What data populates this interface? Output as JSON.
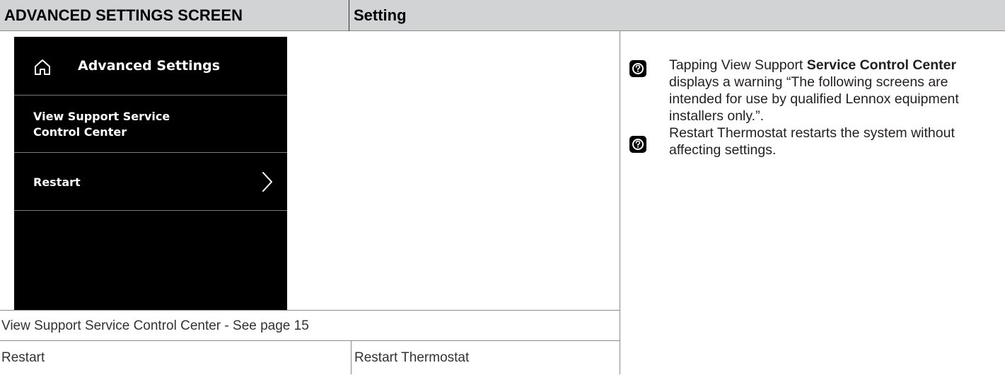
{
  "header": {
    "col1": "ADVANCED SETTINGS SCREEN",
    "col2": "Setting"
  },
  "screen": {
    "title": "Advanced Settings",
    "items": [
      {
        "label": "View Support Service Control Center"
      },
      {
        "label": "Restart"
      }
    ]
  },
  "table": {
    "row1": "View Support Service Control Center - See page 15",
    "row2": {
      "col1": "Restart",
      "col2": "Restart Thermostat"
    }
  },
  "notes": [
    {
      "pre": "Tapping View Support ",
      "bold": "Service Control Center",
      "post": " displays a warning “The following screens are intended for use by qualified Lennox equipment installers only.”."
    },
    {
      "text": "Restart Thermostat restarts the system without affecting settings."
    }
  ]
}
